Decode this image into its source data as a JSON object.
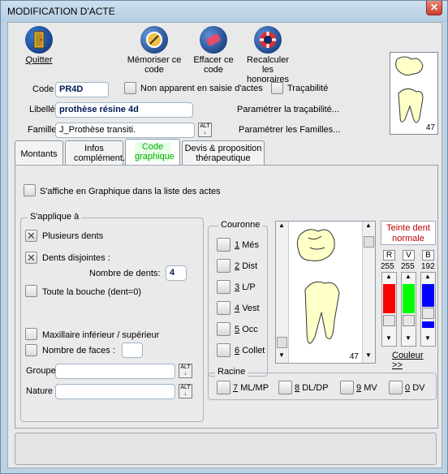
{
  "window": {
    "title": "MODIFICATION D'ACTE",
    "close_icon": "close-icon"
  },
  "toolbar": {
    "quit_label": "Quitter",
    "memorize_label": "Mémoriser ce code",
    "erase_label": "Effacer ce code",
    "recalc_label": "Recalculer les honoraires"
  },
  "form": {
    "code_label": "Code",
    "code_value": "PR4D",
    "not_shown_label": "Non apparent en saisie d'actes",
    "traceability_label": "Traçabilité",
    "libelle_label": "Libellé",
    "libelle_value": "prothèse résine 4d",
    "param_traceability": "Paramétrer la traçabilité...",
    "famille_label": "Famille",
    "famille_value": "J_Prothèse transiti.",
    "param_familles": "Paramétrer les Familles...",
    "alt_label": "ALT",
    "tooth_number": "47"
  },
  "tabs": [
    {
      "label": "Montants"
    },
    {
      "label": "Infos complément."
    },
    {
      "label": "Code graphique"
    },
    {
      "label": "Devis & proposition thérapeutique"
    }
  ],
  "graphic": {
    "show_in_list_label": "S'affiche en Graphique dans la liste des actes",
    "applies_title": "S'applique à",
    "plusieurs_dents": "Plusieurs dents",
    "dents_disjointes": "Dents disjointes :",
    "nombre_dents_label": "Nombre de dents:",
    "nombre_dents_value": "4",
    "toute_bouche": "Toute la bouche (dent=0)",
    "maxillaire": "Maxillaire inférieur / supérieur",
    "nombre_faces": "Nombre de faces :",
    "groupe_label": "Groupe",
    "nature_label": "Nature",
    "couronne_title": "Couronne",
    "couronne_items": [
      {
        "num": "1",
        "label": "Més"
      },
      {
        "num": "2",
        "label": "Dist"
      },
      {
        "num": "3",
        "label": "L/P"
      },
      {
        "num": "4",
        "label": "Vest"
      },
      {
        "num": "5",
        "label": "Occ"
      },
      {
        "num": "6",
        "label": "Collet"
      }
    ],
    "preview_tooth_number": "47",
    "teinte_title": "Teinte dent normale",
    "rvb_labels": [
      "R",
      "V",
      "B"
    ],
    "rvb_values": [
      "255",
      "255",
      "192"
    ],
    "colors": {
      "r": "#ff0000",
      "v": "#00ff00",
      "b": "#0000ff"
    },
    "couleur_label": "Couleur >>",
    "racine_title": "Racine",
    "racine_items": [
      {
        "num": "7",
        "label": "ML/MP"
      },
      {
        "num": "8",
        "label": "DL/DP"
      },
      {
        "num": "9",
        "label": "MV"
      },
      {
        "num": "0",
        "label": "DV"
      }
    ]
  }
}
